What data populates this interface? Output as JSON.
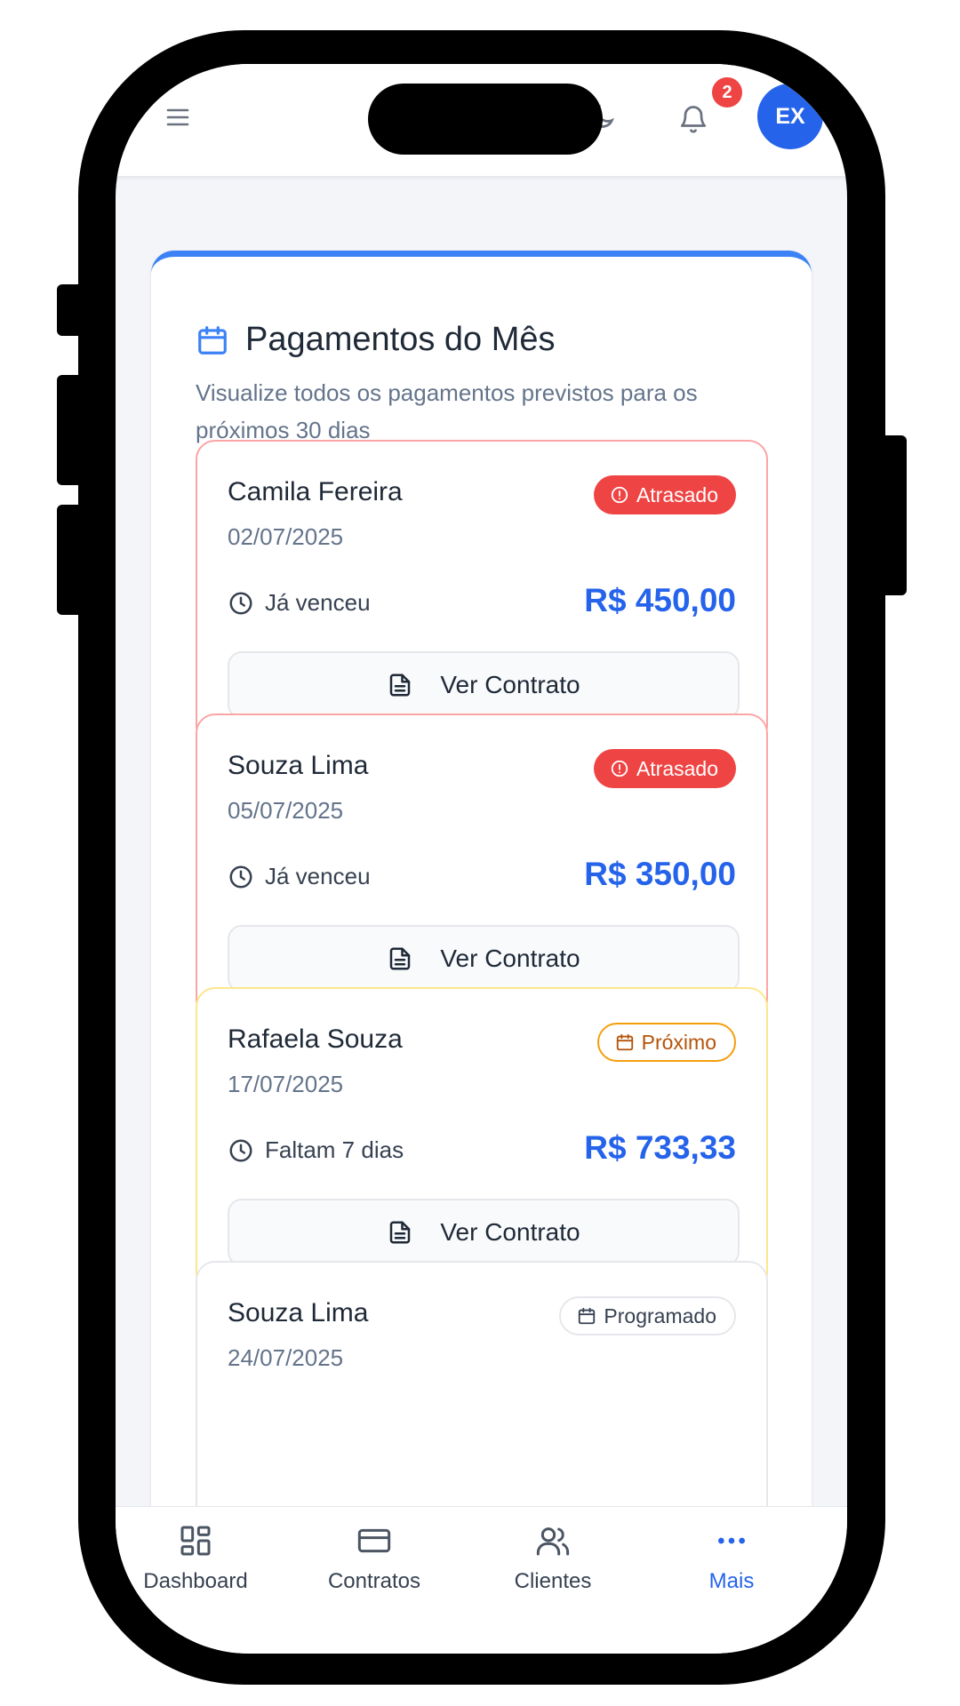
{
  "header": {
    "notification_count": "2",
    "avatar_initials": "EX"
  },
  "section": {
    "title": "Pagamentos do Mês",
    "subtitle": "Visualize todos os pagamentos previstos para os próximos 30 dias"
  },
  "payments": [
    {
      "name": "Camila Fereira",
      "date": "02/07/2025",
      "status": "Atrasado",
      "status_icon": "alert-circle-icon",
      "due_text": "Já venceu",
      "amount": "R$ 450,00",
      "button": "Ver Contrato"
    },
    {
      "name": "Souza Lima",
      "date": "05/07/2025",
      "status": "Atrasado",
      "status_icon": "alert-circle-icon",
      "due_text": "Já venceu",
      "amount": "R$ 350,00",
      "button": "Ver Contrato"
    },
    {
      "name": "Rafaela Souza",
      "date": "17/07/2025",
      "status": "Próximo",
      "status_icon": "calendar-icon",
      "due_text": "Faltam 7 dias",
      "amount": "R$ 733,33",
      "button": "Ver Contrato"
    },
    {
      "name": "Souza Lima",
      "date": "24/07/2025",
      "status": "Programado",
      "status_icon": "calendar-icon"
    }
  ],
  "bottom_nav": [
    {
      "label": "Dashboard",
      "icon": "dashboard-icon"
    },
    {
      "label": "Contratos",
      "icon": "credit-card-icon"
    },
    {
      "label": "Clientes",
      "icon": "users-icon"
    },
    {
      "label": "Mais",
      "icon": "more-icon",
      "active": true
    }
  ],
  "colors": {
    "accent": "#2563eb",
    "overdue": "#ef4444",
    "upcoming": "#f59e0b",
    "overdue_border": "#fca5a5",
    "upcoming_border": "#fde68a"
  }
}
